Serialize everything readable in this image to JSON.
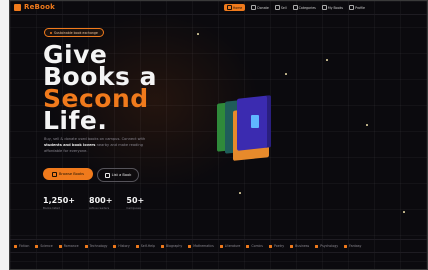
{
  "brand": {
    "name": "ReBook",
    "accent": "#f07a1c"
  },
  "nav": [
    {
      "label": "Home",
      "icon": "home-icon",
      "active": true
    },
    {
      "label": "Donate",
      "icon": "gift-icon"
    },
    {
      "label": "Sell",
      "icon": "tag-icon"
    },
    {
      "label": "Categories",
      "icon": "grid-icon"
    },
    {
      "label": "My Books",
      "icon": "book-icon"
    },
    {
      "label": "Profile",
      "icon": "user-icon"
    }
  ],
  "hero": {
    "badge": "Sustainable book exchange",
    "title_line1": "Give",
    "title_line2": "Books a",
    "title_line3": "Second",
    "title_line4": "Life.",
    "description_pre": "Buy, sell & donate used books on campus. Connect with",
    "description_bold": "students and book lovers",
    "description_post": "nearby and make reading affordable for everyone.",
    "primary_button": "Browse Books",
    "secondary_button": "List a Book"
  },
  "stats": [
    {
      "value": "1,250+",
      "label": "Books listed"
    },
    {
      "value": "800+",
      "label": "Active readers"
    },
    {
      "value": "50+",
      "label": "Campuses"
    }
  ],
  "ticker": [
    "Fiction",
    "Science",
    "Romance",
    "Technology",
    "History",
    "Self-Help",
    "Biography",
    "Mathematics",
    "Literature",
    "Comics",
    "Poetry",
    "Business",
    "Psychology",
    "Fantasy"
  ]
}
